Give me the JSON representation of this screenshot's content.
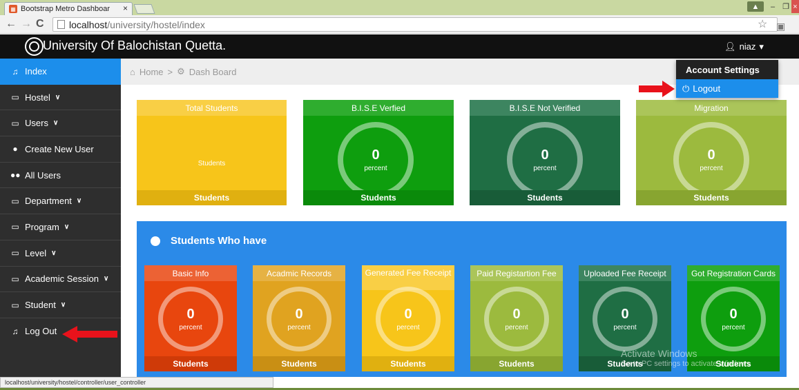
{
  "browser": {
    "tab_title": "Bootstrap Metro Dashboar",
    "tab_close": "×",
    "url_host": "localhost",
    "url_path": "/university/hostel/index",
    "status_url": "localhost/university/hostel/controller/user_controller"
  },
  "header": {
    "title": "University Of Balochistan Quetta.",
    "user_name": "niaz"
  },
  "dropdown": {
    "settings_label": "Account Settings",
    "logout_label": "Logout"
  },
  "breadcrumb": {
    "home": "Home",
    "separator": ">",
    "dashboard": "Dash Board"
  },
  "sidebar": {
    "items": [
      {
        "label": "Index",
        "icon": "bell-icon"
      },
      {
        "label": "Hostel",
        "icon": "folder-icon"
      },
      {
        "label": "Users",
        "icon": "folder-icon"
      },
      {
        "label": "Create New User",
        "icon": "user-icon"
      },
      {
        "label": "All Users",
        "icon": "users-icon"
      },
      {
        "label": "Department",
        "icon": "folder-icon"
      },
      {
        "label": "Program",
        "icon": "folder-icon"
      },
      {
        "label": "Level",
        "icon": "folder-icon"
      },
      {
        "label": "Academic Session",
        "icon": "folder-icon"
      },
      {
        "label": "Student",
        "icon": "folder-icon"
      },
      {
        "label": "Log Out",
        "icon": "bell-icon"
      }
    ]
  },
  "stat_tiles": [
    {
      "title": "Total Students",
      "body": "Students",
      "footer": "Students",
      "color": "#f7c51a"
    },
    {
      "title": "B.I.S.E Verfied",
      "value": "0",
      "unit": "percent",
      "footer": "Students",
      "color": "#0e9e0e"
    },
    {
      "title": "B.I.S.E Not Verified",
      "value": "0",
      "unit": "percent",
      "footer": "Students",
      "color": "#1f6e44"
    },
    {
      "title": "Migration",
      "value": "0",
      "unit": "percent",
      "footer": "Students",
      "color": "#9cba3e"
    }
  ],
  "panel": {
    "title": "Students Who have",
    "tiles": [
      {
        "title": "Basic Info",
        "value": "0",
        "unit": "percent",
        "footer": "Students",
        "color": "#e8460e"
      },
      {
        "title": "Acadmic Records",
        "value": "0",
        "unit": "percent",
        "footer": "Students",
        "color": "#e0a320"
      },
      {
        "title": "Generated Fee Receipt",
        "value": "0",
        "unit": "percent",
        "footer": "Students",
        "color": "#f7c51a"
      },
      {
        "title": "Paid Registartion Fee",
        "value": "0",
        "unit": "percent",
        "footer": "Students",
        "color": "#9cba3e"
      },
      {
        "title": "Uploaded Fee Receipt",
        "value": "0",
        "unit": "percent",
        "footer": "Students",
        "color": "#1f6e44"
      },
      {
        "title": "Got Registration Cards",
        "value": "0",
        "unit": "percent",
        "footer": "Students",
        "color": "#0e9e0e"
      }
    ]
  },
  "watermark": {
    "line1": "Activate Windows",
    "line2": "Go to PC settings to activate Windows"
  }
}
